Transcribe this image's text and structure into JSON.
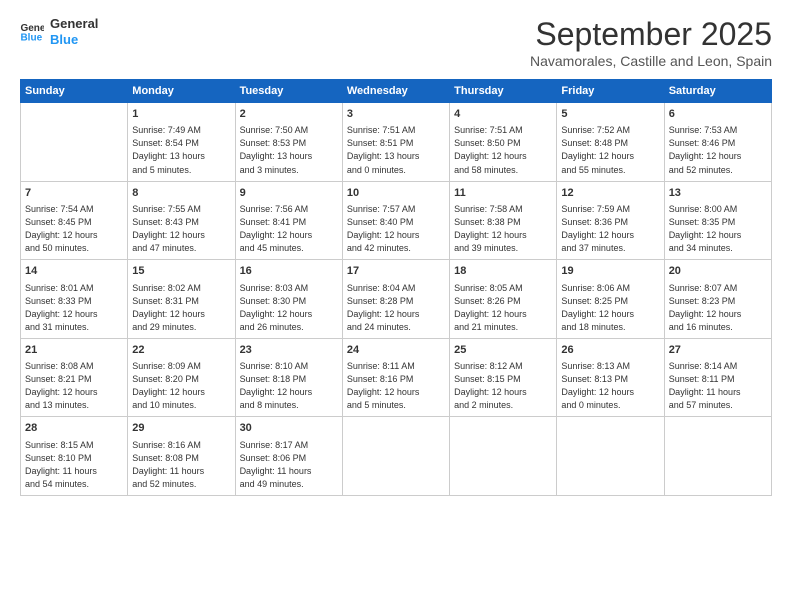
{
  "header": {
    "logo_line1": "General",
    "logo_line2": "Blue",
    "month_title": "September 2025",
    "subtitle": "Navamorales, Castille and Leon, Spain"
  },
  "weekdays": [
    "Sunday",
    "Monday",
    "Tuesday",
    "Wednesday",
    "Thursday",
    "Friday",
    "Saturday"
  ],
  "weeks": [
    [
      {
        "day": "",
        "info": ""
      },
      {
        "day": "1",
        "info": "Sunrise: 7:49 AM\nSunset: 8:54 PM\nDaylight: 13 hours\nand 5 minutes."
      },
      {
        "day": "2",
        "info": "Sunrise: 7:50 AM\nSunset: 8:53 PM\nDaylight: 13 hours\nand 3 minutes."
      },
      {
        "day": "3",
        "info": "Sunrise: 7:51 AM\nSunset: 8:51 PM\nDaylight: 13 hours\nand 0 minutes."
      },
      {
        "day": "4",
        "info": "Sunrise: 7:51 AM\nSunset: 8:50 PM\nDaylight: 12 hours\nand 58 minutes."
      },
      {
        "day": "5",
        "info": "Sunrise: 7:52 AM\nSunset: 8:48 PM\nDaylight: 12 hours\nand 55 minutes."
      },
      {
        "day": "6",
        "info": "Sunrise: 7:53 AM\nSunset: 8:46 PM\nDaylight: 12 hours\nand 52 minutes."
      }
    ],
    [
      {
        "day": "7",
        "info": "Sunrise: 7:54 AM\nSunset: 8:45 PM\nDaylight: 12 hours\nand 50 minutes."
      },
      {
        "day": "8",
        "info": "Sunrise: 7:55 AM\nSunset: 8:43 PM\nDaylight: 12 hours\nand 47 minutes."
      },
      {
        "day": "9",
        "info": "Sunrise: 7:56 AM\nSunset: 8:41 PM\nDaylight: 12 hours\nand 45 minutes."
      },
      {
        "day": "10",
        "info": "Sunrise: 7:57 AM\nSunset: 8:40 PM\nDaylight: 12 hours\nand 42 minutes."
      },
      {
        "day": "11",
        "info": "Sunrise: 7:58 AM\nSunset: 8:38 PM\nDaylight: 12 hours\nand 39 minutes."
      },
      {
        "day": "12",
        "info": "Sunrise: 7:59 AM\nSunset: 8:36 PM\nDaylight: 12 hours\nand 37 minutes."
      },
      {
        "day": "13",
        "info": "Sunrise: 8:00 AM\nSunset: 8:35 PM\nDaylight: 12 hours\nand 34 minutes."
      }
    ],
    [
      {
        "day": "14",
        "info": "Sunrise: 8:01 AM\nSunset: 8:33 PM\nDaylight: 12 hours\nand 31 minutes."
      },
      {
        "day": "15",
        "info": "Sunrise: 8:02 AM\nSunset: 8:31 PM\nDaylight: 12 hours\nand 29 minutes."
      },
      {
        "day": "16",
        "info": "Sunrise: 8:03 AM\nSunset: 8:30 PM\nDaylight: 12 hours\nand 26 minutes."
      },
      {
        "day": "17",
        "info": "Sunrise: 8:04 AM\nSunset: 8:28 PM\nDaylight: 12 hours\nand 24 minutes."
      },
      {
        "day": "18",
        "info": "Sunrise: 8:05 AM\nSunset: 8:26 PM\nDaylight: 12 hours\nand 21 minutes."
      },
      {
        "day": "19",
        "info": "Sunrise: 8:06 AM\nSunset: 8:25 PM\nDaylight: 12 hours\nand 18 minutes."
      },
      {
        "day": "20",
        "info": "Sunrise: 8:07 AM\nSunset: 8:23 PM\nDaylight: 12 hours\nand 16 minutes."
      }
    ],
    [
      {
        "day": "21",
        "info": "Sunrise: 8:08 AM\nSunset: 8:21 PM\nDaylight: 12 hours\nand 13 minutes."
      },
      {
        "day": "22",
        "info": "Sunrise: 8:09 AM\nSunset: 8:20 PM\nDaylight: 12 hours\nand 10 minutes."
      },
      {
        "day": "23",
        "info": "Sunrise: 8:10 AM\nSunset: 8:18 PM\nDaylight: 12 hours\nand 8 minutes."
      },
      {
        "day": "24",
        "info": "Sunrise: 8:11 AM\nSunset: 8:16 PM\nDaylight: 12 hours\nand 5 minutes."
      },
      {
        "day": "25",
        "info": "Sunrise: 8:12 AM\nSunset: 8:15 PM\nDaylight: 12 hours\nand 2 minutes."
      },
      {
        "day": "26",
        "info": "Sunrise: 8:13 AM\nSunset: 8:13 PM\nDaylight: 12 hours\nand 0 minutes."
      },
      {
        "day": "27",
        "info": "Sunrise: 8:14 AM\nSunset: 8:11 PM\nDaylight: 11 hours\nand 57 minutes."
      }
    ],
    [
      {
        "day": "28",
        "info": "Sunrise: 8:15 AM\nSunset: 8:10 PM\nDaylight: 11 hours\nand 54 minutes."
      },
      {
        "day": "29",
        "info": "Sunrise: 8:16 AM\nSunset: 8:08 PM\nDaylight: 11 hours\nand 52 minutes."
      },
      {
        "day": "30",
        "info": "Sunrise: 8:17 AM\nSunset: 8:06 PM\nDaylight: 11 hours\nand 49 minutes."
      },
      {
        "day": "",
        "info": ""
      },
      {
        "day": "",
        "info": ""
      },
      {
        "day": "",
        "info": ""
      },
      {
        "day": "",
        "info": ""
      }
    ]
  ]
}
